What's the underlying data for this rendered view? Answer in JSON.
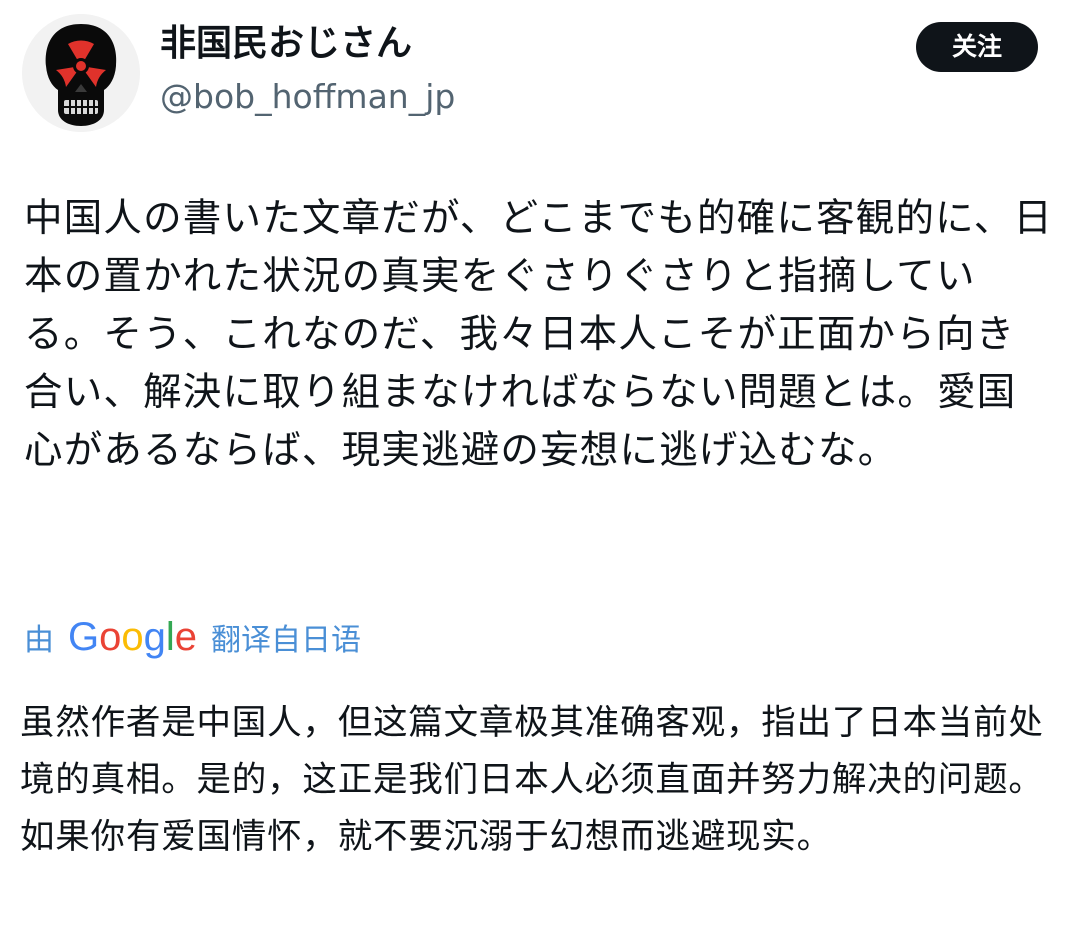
{
  "author": {
    "display_name": "非国民おじさん",
    "handle": "@bob_hoffman_jp",
    "avatar_icon": "skull-radiation-icon"
  },
  "actions": {
    "follow_label": "关注"
  },
  "tweet": {
    "text": "中国人の書いた文章だが、どこまでも的確に客観的に、日本の置かれた状況の真実をぐさりぐさりと指摘している。そう、これなのだ、我々日本人こそが正面から向き合い、解決に取り組まなければならない問題とは。愛国心があるならば、現実逃避の妄想に逃げ込むな。"
  },
  "translation": {
    "by_label": "由",
    "logo_text": "Google",
    "from_label": "翻译自日语",
    "text": "虽然作者是中国人，但这篇文章极其准确客观，指出了日本当前处境的真相。是的，这正是我们日本人必须直面并努力解决的问题。如果你有爱国情怀，就不要沉溺于幻想而逃避现实。"
  },
  "colors": {
    "text": "#0f1419",
    "secondary": "#536471",
    "link": "#4a8fd6",
    "button_bg": "#0f1419",
    "button_text": "#ffffff",
    "avatar_accent": "#e0322b"
  }
}
